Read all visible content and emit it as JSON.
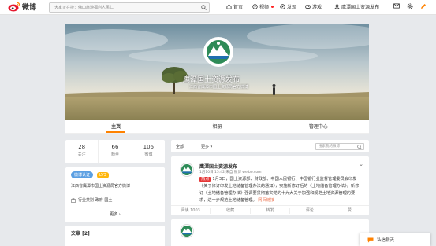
{
  "topbar": {
    "logo_text": "微博",
    "search_placeholder": "大家正在搜：佛山旅游福利人民仁",
    "nav": [
      {
        "label": "首页",
        "icon": "home-icon"
      },
      {
        "label": "视频",
        "icon": "video-icon"
      },
      {
        "label": "发现",
        "icon": "discover-icon"
      },
      {
        "label": "游戏",
        "icon": "game-icon"
      },
      {
        "label": "鹰潭国土资源发布",
        "icon": "user-icon"
      }
    ],
    "mail_icon": "mail-icon",
    "settings_icon": "gear-icon",
    "compose_icon": "compose-icon"
  },
  "profile": {
    "name": "鹰潭国土资源发布",
    "description": "江西省鹰潭市国土资源局官方微博",
    "avatar_text": "国土资源"
  },
  "tabs": [
    {
      "label": "主页",
      "active": true
    },
    {
      "label": "相册",
      "active": false
    },
    {
      "label": "管理中心",
      "active": false
    }
  ],
  "stats": [
    {
      "value": "28",
      "label": "关注"
    },
    {
      "value": "66",
      "label": "粉丝"
    },
    {
      "value": "106",
      "label": "微博"
    }
  ],
  "info": {
    "verified_badge": "微博认证",
    "level_badge": "LV3",
    "verify_desc": "江西省鹰潭市国土资源局官方微博",
    "industry": "行业类别  政府-国土",
    "more": "更多 ›"
  },
  "articles": {
    "title": "文章 [2]"
  },
  "filter": {
    "all": "全部",
    "more": "更多 ▾",
    "search_placeholder": "搜索我的微博"
  },
  "post": {
    "author": "鹰潭国土资源发布",
    "meta": "1月10日 15:42 来自 微博 weibo.com",
    "tag": "热点",
    "body": "1月3日，国土资源部、财政部、中国人民银行、中国银行业监督管理委员会印发《关于修订印发土地储备管理办法的通知》，实施新修订后的《土地储备管理办法》。新修订《土地储备管理办法》强调要贯彻落实党的十九大关于加强和规范土地资源管理的要求，进一步规范土地储备管理。",
    "link": "网页链接",
    "actions": [
      "收藏",
      "转发",
      "评论",
      "赞"
    ],
    "read_count": "阅读 1003"
  },
  "chat": {
    "label": "私信聊天"
  },
  "colors": {
    "accent": "#ff8200",
    "brand_blue": "#5b9fe2",
    "link": "#eb7350"
  }
}
